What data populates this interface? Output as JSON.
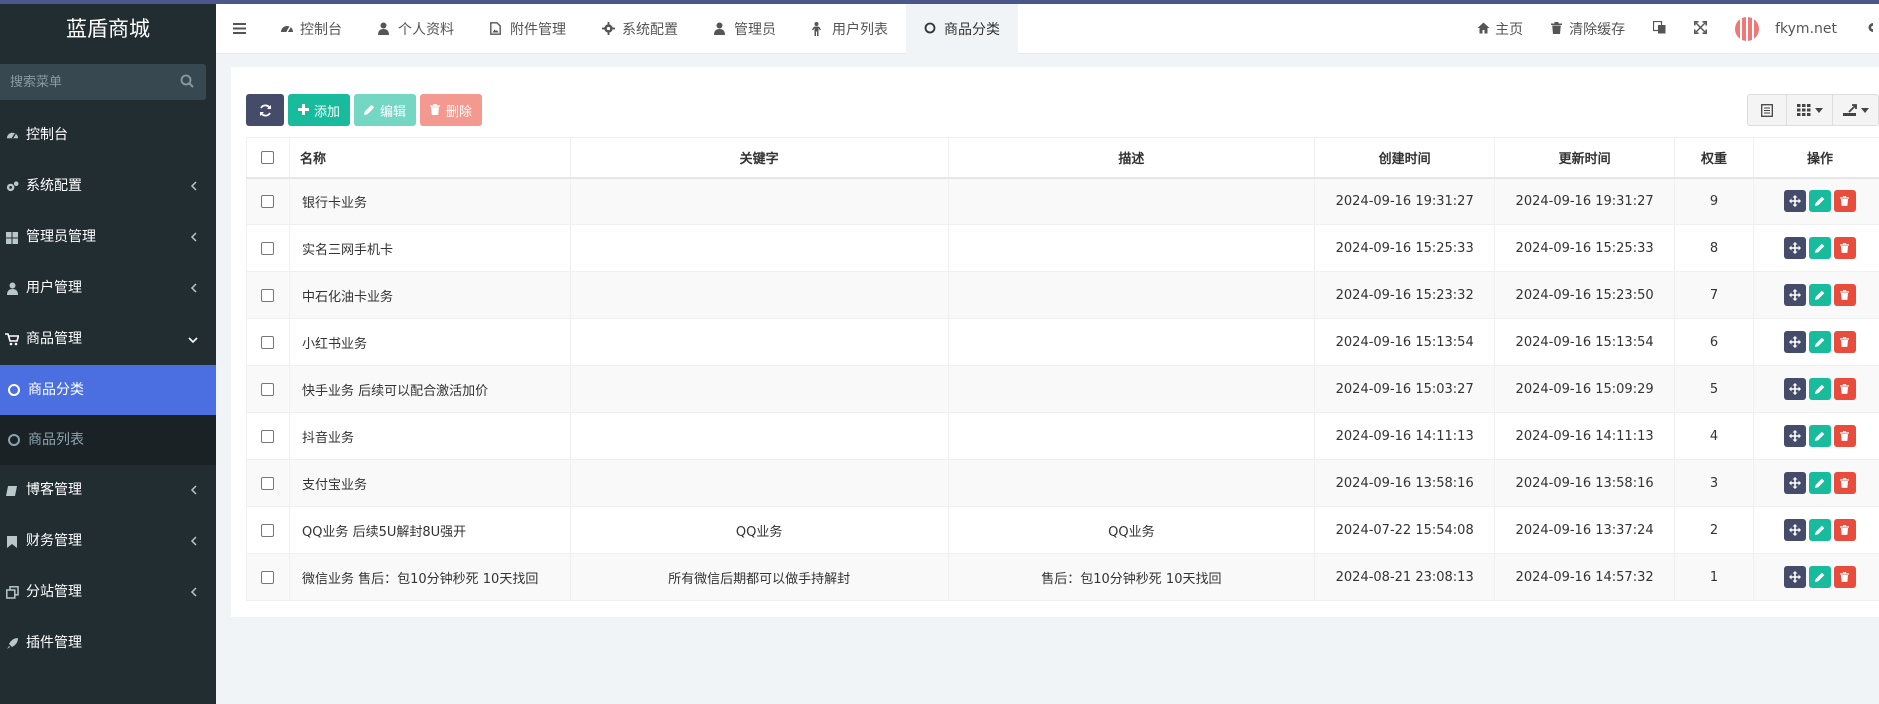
{
  "brand": "蓝盾商城",
  "search": {
    "placeholder": "搜索菜单"
  },
  "sidebar": {
    "items": [
      {
        "label": "控制台",
        "icon": "dashboard-icon"
      },
      {
        "label": "系统配置",
        "icon": "gears-icon"
      },
      {
        "label": "管理员管理",
        "icon": "windows-icon"
      },
      {
        "label": "用户管理",
        "icon": "user-icon"
      },
      {
        "label": "商品管理",
        "icon": "cart-icon"
      },
      {
        "label": "博客管理",
        "icon": "book-icon"
      },
      {
        "label": "财务管理",
        "icon": "bookmark-icon"
      },
      {
        "label": "分站管理",
        "icon": "clone-icon"
      },
      {
        "label": "插件管理",
        "icon": "rocket-icon"
      }
    ],
    "sub_items": [
      {
        "label": "商品分类"
      },
      {
        "label": "商品列表"
      }
    ]
  },
  "header": {
    "tabs": [
      {
        "label": "控制台",
        "icon": "dashboard-icon"
      },
      {
        "label": "个人资料",
        "icon": "user-icon"
      },
      {
        "label": "附件管理",
        "icon": "file-image-icon"
      },
      {
        "label": "系统配置",
        "icon": "gear-icon"
      },
      {
        "label": "管理员",
        "icon": "user-icon"
      },
      {
        "label": "用户列表",
        "icon": "child-icon"
      },
      {
        "label": "商品分类",
        "icon": "circle-icon"
      }
    ],
    "right": {
      "home": "主页",
      "clear_cache": "清除缓存",
      "username": "fkym.net"
    }
  },
  "toolbar": {
    "add": "添加",
    "edit": "编辑",
    "delete": "删除"
  },
  "table": {
    "headers": {
      "name": "名称",
      "keywords": "关键字",
      "description": "描述",
      "created": "创建时间",
      "updated": "更新时间",
      "weight": "权重",
      "ops": "操作"
    },
    "rows": [
      {
        "name": "银行卡业务",
        "keywords": "",
        "description": "",
        "created": "2024-09-16 19:31:27",
        "updated": "2024-09-16 19:31:27",
        "weight": "9"
      },
      {
        "name": "实名三网手机卡",
        "keywords": "",
        "description": "",
        "created": "2024-09-16 15:25:33",
        "updated": "2024-09-16 15:25:33",
        "weight": "8"
      },
      {
        "name": "中石化油卡业务",
        "keywords": "",
        "description": "",
        "created": "2024-09-16 15:23:32",
        "updated": "2024-09-16 15:23:50",
        "weight": "7"
      },
      {
        "name": "小红书业务",
        "keywords": "",
        "description": "",
        "created": "2024-09-16 15:13:54",
        "updated": "2024-09-16 15:13:54",
        "weight": "6"
      },
      {
        "name": "快手业务 后续可以配合激活加价",
        "keywords": "",
        "description": "",
        "created": "2024-09-16 15:03:27",
        "updated": "2024-09-16 15:09:29",
        "weight": "5"
      },
      {
        "name": "抖音业务",
        "keywords": "",
        "description": "",
        "created": "2024-09-16 14:11:13",
        "updated": "2024-09-16 14:11:13",
        "weight": "4"
      },
      {
        "name": "支付宝业务",
        "keywords": "",
        "description": "",
        "created": "2024-09-16 13:58:16",
        "updated": "2024-09-16 13:58:16",
        "weight": "3"
      },
      {
        "name": "QQ业务 后续5U解封8U强开",
        "keywords": "QQ业务",
        "description": "QQ业务",
        "created": "2024-07-22 15:54:08",
        "updated": "2024-09-16 13:37:24",
        "weight": "2"
      },
      {
        "name": "微信业务 售后：包10分钟秒死 10天找回",
        "keywords": "所有微信后期都可以做手持解封",
        "description": "售后：包10分钟秒死 10天找回",
        "created": "2024-08-21 23:08:13",
        "updated": "2024-09-16 14:57:32",
        "weight": "1"
      }
    ]
  },
  "colors": {
    "sidebar_bg": "#222d32",
    "active_item": "#4b6fe0",
    "dark_btn": "#444c69",
    "green": "#18bc9c",
    "red": "#e74c3c"
  }
}
